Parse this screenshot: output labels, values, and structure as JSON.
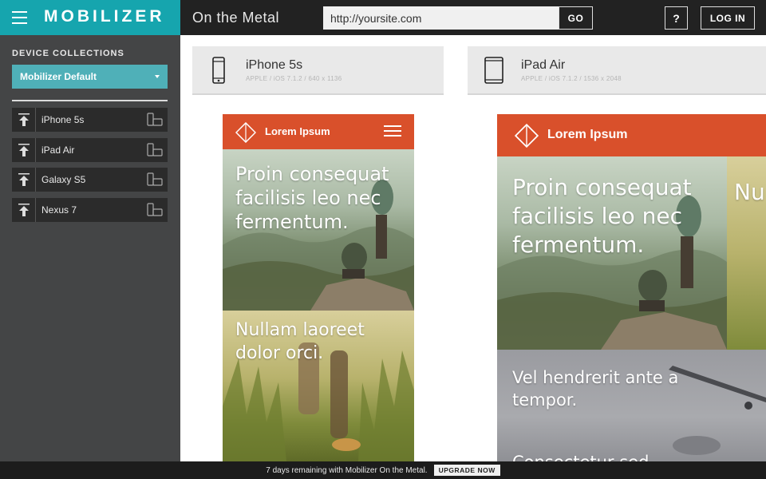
{
  "app": {
    "logo": "MOBILIZER",
    "page_title": "On the Metal"
  },
  "url_bar": {
    "value": "http://yoursite.com",
    "go_label": "GO"
  },
  "header_actions": {
    "help_label": "?",
    "login_label": "LOG IN"
  },
  "sidebar": {
    "heading": "DEVICE COLLECTIONS",
    "selected_collection": "Mobilizer Default",
    "devices": [
      {
        "name": "iPhone 5s"
      },
      {
        "name": "iPad Air"
      },
      {
        "name": "Galaxy S5"
      },
      {
        "name": "Nexus 7"
      }
    ]
  },
  "panels": [
    {
      "device_name": "iPhone 5s",
      "device_spec": "APPLE / iOS 7.1.2 / 640 x 1136",
      "icon": "phone-icon",
      "site_title": "Lorem Ipsum",
      "hero_text": "Proin consequat facilisis leo nec fermentum.",
      "second_text": "Nullam laoreet dolor orci."
    },
    {
      "device_name": "iPad Air",
      "device_spec": "APPLE / iOS 7.1.2 / 1536 x 2048",
      "icon": "tablet-icon",
      "site_title": "Lorem Ipsum",
      "hero_text": "Proin consequat facilisis leo nec fermentum.",
      "side_text": "Nu do",
      "second_text": "Vel hendrerit ante a tempor.",
      "third_text": "Consectetur sed"
    }
  ],
  "footer": {
    "message": "7 days remaining with Mobilizer On the Metal.",
    "upgrade_label": "UPGRADE NOW"
  },
  "colors": {
    "brand": "#16a5ae",
    "topbar": "#222222",
    "sidebar": "#444546",
    "accent_select": "#4fb0b8",
    "site_header": "#d9502b"
  }
}
